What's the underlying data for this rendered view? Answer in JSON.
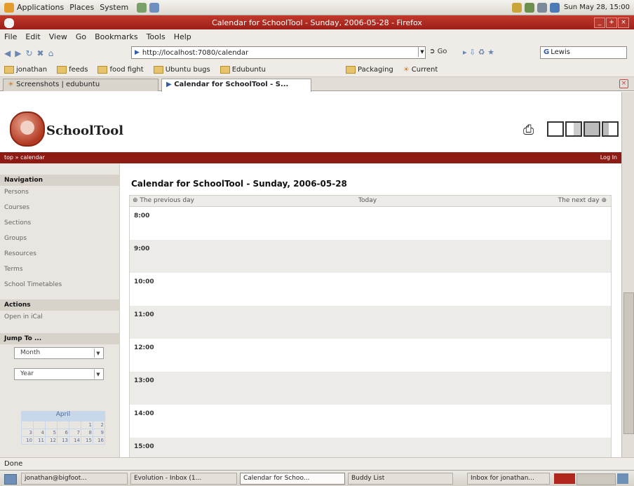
{
  "gnome_panel": {
    "menus": [
      "Applications",
      "Places",
      "System"
    ],
    "clock": "Sun May 28, 15:00"
  },
  "window": {
    "title": "Calendar for SchoolTool - Sunday, 2006-05-28 - Firefox"
  },
  "menubar": [
    "File",
    "Edit",
    "View",
    "Go",
    "Bookmarks",
    "Tools",
    "Help"
  ],
  "navbar": {
    "url": "http://localhost:7080/calendar",
    "go_label": "Go",
    "search_value": "Lewis"
  },
  "bookmarks": [
    "jonathan",
    "feeds",
    "food fight",
    "Ubuntu bugs",
    "Edubuntu",
    "Packaging",
    "Current"
  ],
  "tabs": [
    "Screenshots | edubuntu",
    "Calendar for SchoolTool - S..."
  ],
  "schooltool": {
    "name": "SchoolTool",
    "crumb": "top » calendar",
    "login": "Log In"
  },
  "sidebar": {
    "navigation_header": "Navigation",
    "navigation_items": [
      "Persons",
      "Courses",
      "Sections",
      "Groups",
      "Resources",
      "Terms",
      "School Timetables"
    ],
    "actions_header": "Actions",
    "actions_items": [
      "Open in iCal"
    ],
    "jump_header": "Jump To ...",
    "month_select": "Month",
    "year_select": "Year",
    "minical_month": "April",
    "minical_rows": [
      [
        "",
        "",
        "",
        "",
        "",
        "1",
        "2"
      ],
      [
        "3",
        "4",
        "5",
        "6",
        "7",
        "8",
        "9"
      ],
      [
        "10",
        "11",
        "12",
        "13",
        "14",
        "15",
        "16"
      ]
    ]
  },
  "calendar": {
    "title": "Calendar for SchoolTool - Sunday, 2006-05-28",
    "prev_label": "The previous day",
    "today_label": "Today",
    "next_label": "The next day",
    "hours": [
      "8:00",
      "9:00",
      "10:00",
      "11:00",
      "12:00",
      "13:00",
      "14:00",
      "15:00"
    ]
  },
  "status": "Done",
  "taskbar": [
    "jonathan@bigfoot...",
    "Evolution - Inbox (1...",
    "Calendar for Schoo...",
    "Buddy List",
    "Inbox for jonathan..."
  ]
}
